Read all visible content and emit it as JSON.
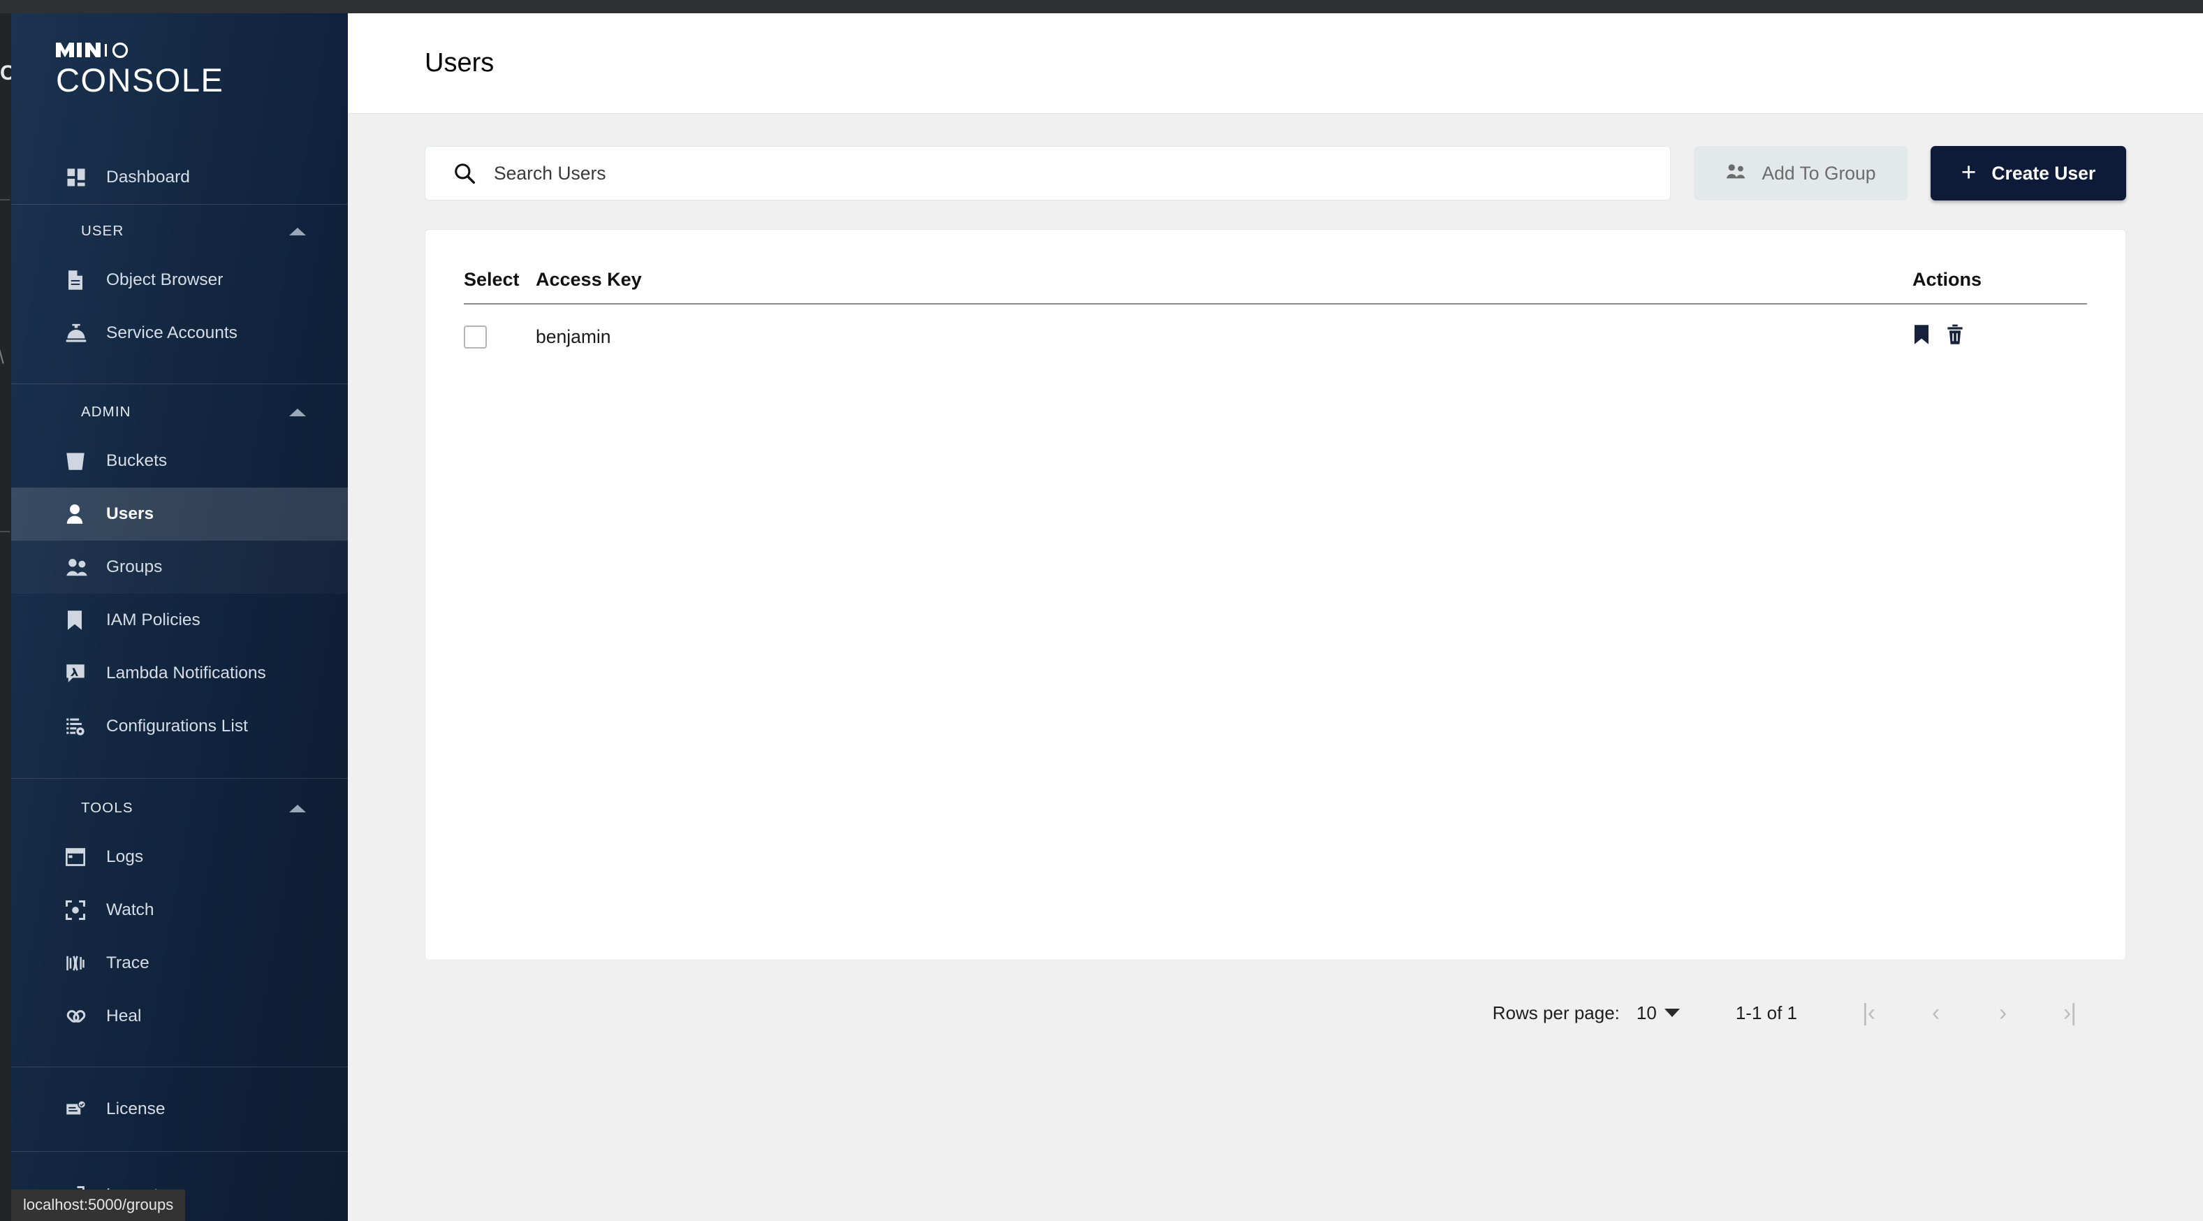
{
  "window": {
    "status_bar_text": "localhost:5000/groups",
    "ghost_letter_c": "C",
    "ghost_letter_w": "\\"
  },
  "sidebar": {
    "brand_top": "MINIO",
    "brand_bottom": "CONSOLE",
    "dashboard": {
      "label": "Dashboard",
      "icon": "dashboard-icon"
    },
    "sections": [
      {
        "title": "USER",
        "items": [
          {
            "label": "Object Browser",
            "icon": "document-icon"
          },
          {
            "label": "Service Accounts",
            "icon": "service-bell-icon"
          }
        ]
      },
      {
        "title": "ADMIN",
        "items": [
          {
            "label": "Buckets",
            "icon": "bucket-icon"
          },
          {
            "label": "Users",
            "icon": "user-icon"
          },
          {
            "label": "Groups",
            "icon": "groups-icon"
          },
          {
            "label": "IAM Policies",
            "icon": "bookmark-icon"
          },
          {
            "label": "Lambda Notifications",
            "icon": "lambda-icon"
          },
          {
            "label": "Configurations List",
            "icon": "settings-list-icon"
          }
        ]
      },
      {
        "title": "TOOLS",
        "items": [
          {
            "label": "Logs",
            "icon": "logs-window-icon"
          },
          {
            "label": "Watch",
            "icon": "watch-target-icon"
          },
          {
            "label": "Trace",
            "icon": "trace-lines-icon"
          },
          {
            "label": "Heal",
            "icon": "bandage-icon"
          }
        ]
      }
    ],
    "license": {
      "label": "License",
      "icon": "license-check-icon"
    },
    "logout": {
      "label": "Logout",
      "icon": "logout-arrow-icon"
    },
    "active_item": "Users",
    "colors": {
      "background_start": "#1b3350",
      "background_end": "#0e1d33",
      "active_highlight": "rgba(255,255,255,0.14)"
    }
  },
  "header": {
    "title": "Users"
  },
  "toolbar": {
    "search_placeholder": "Search Users",
    "search_value": "",
    "search_icon": "search-icon",
    "add_to_group_label": "Add To Group",
    "add_to_group_icon": "groups-icon",
    "add_to_group_disabled": true,
    "create_user_label": "Create User",
    "create_user_icon": "plus-icon",
    "create_user_color": "#0d1b38"
  },
  "table": {
    "columns": [
      "Select",
      "Access Key",
      "Actions"
    ],
    "rows": [
      {
        "selected": false,
        "access_key": "benjamin",
        "actions": [
          "bookmark-icon",
          "trash-icon"
        ]
      }
    ]
  },
  "pagination": {
    "rows_per_page_label": "Rows per page:",
    "rows_per_page_value": "10",
    "range_label": "1-1 of 1",
    "first_page_icon": "first-page-icon",
    "prev_page_icon": "prev-page-icon",
    "next_page_icon": "next-page-icon",
    "last_page_icon": "last-page-icon",
    "first_page_glyph": "|‹",
    "prev_page_glyph": "‹",
    "next_page_glyph": "›",
    "last_page_glyph": "›|"
  }
}
